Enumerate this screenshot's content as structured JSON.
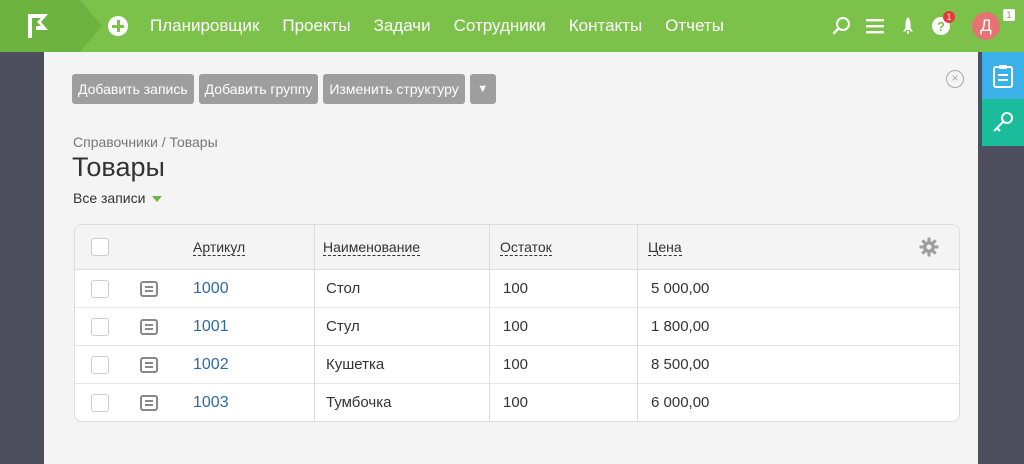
{
  "nav": [
    "Планировщик",
    "Проекты",
    "Задачи",
    "Сотрудники",
    "Контакты",
    "Отчеты"
  ],
  "header": {
    "help_badge": "1",
    "avatar_letter": "Д",
    "avatar_badge": "1"
  },
  "toolbar": {
    "add_record": "Добавить запись",
    "add_group": "Добавить группу",
    "edit_structure": "Изменить структуру",
    "more": "▼"
  },
  "breadcrumb": "Справочники / Товары",
  "page_title": "Товары",
  "filter": "Все записи",
  "table": {
    "columns": [
      "Артикул",
      "Наименование",
      "Остаток",
      "Цена"
    ],
    "rows": [
      {
        "article": "1000",
        "name": "Стол",
        "stock": "100",
        "price": "5 000,00"
      },
      {
        "article": "1001",
        "name": "Стул",
        "stock": "100",
        "price": "1 800,00"
      },
      {
        "article": "1002",
        "name": "Кушетка",
        "stock": "100",
        "price": "8 500,00"
      },
      {
        "article": "1003",
        "name": "Тумбочка",
        "stock": "100",
        "price": "6 000,00"
      }
    ]
  },
  "colors": {
    "brand_green": "#7cc24a",
    "side_blue": "#3ab1e8",
    "side_teal": "#1bbc9b"
  },
  "icons": [
    "flag-logo-icon",
    "plus-circle-icon",
    "search-icon",
    "menu-icon",
    "rocket-icon",
    "help-icon",
    "clipboard-icon",
    "key-icon",
    "close-icon",
    "gear-icon",
    "document-icon"
  ]
}
